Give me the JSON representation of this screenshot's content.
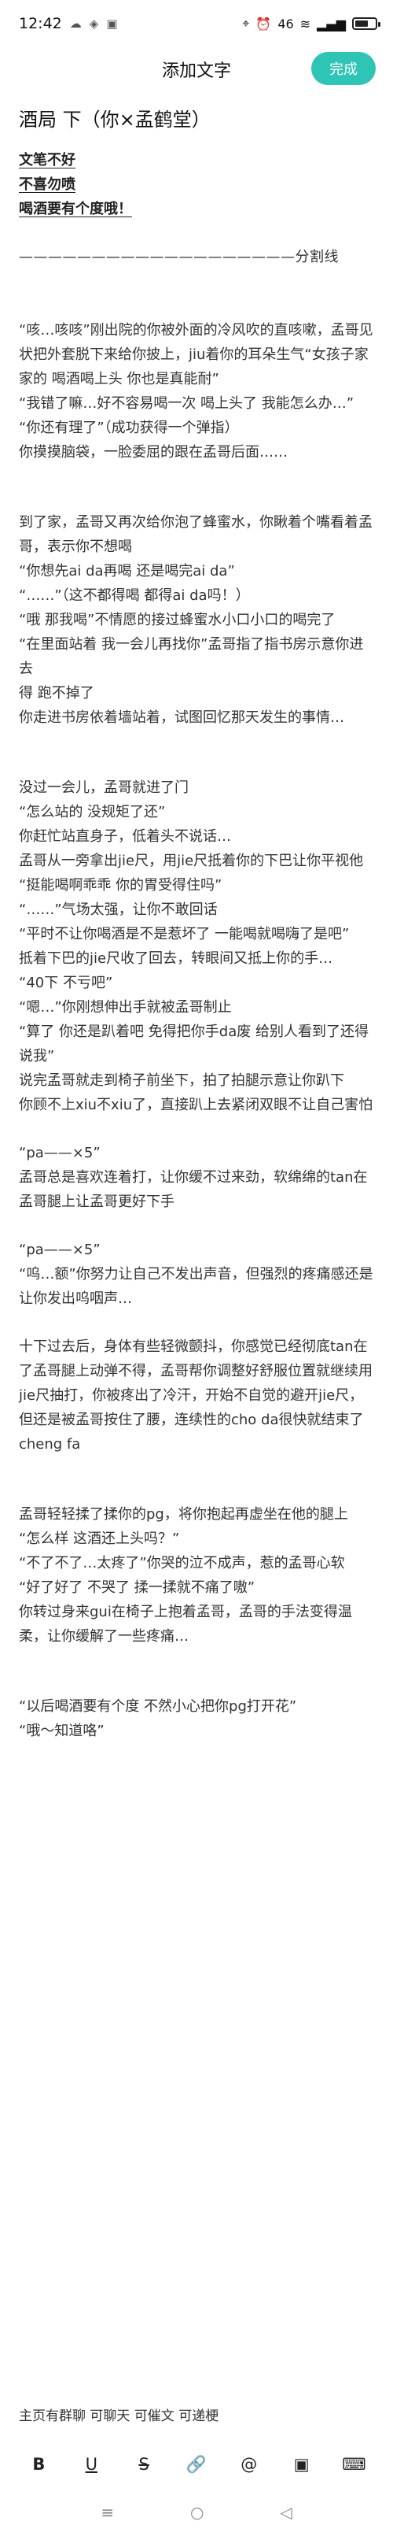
{
  "status_bar": {
    "time": "12:42",
    "signal": "46",
    "battery_level": 0.65
  },
  "header": {
    "title": "添加文字",
    "done_label": "完成"
  },
  "document": {
    "title": "酒局 下（你×孟鹤堂）",
    "warnings": [
      "文笔不好",
      "不喜勿喷",
      "喝酒要有个度哦！"
    ],
    "divider": "———————————————————分割线",
    "para1": [
      "“咳…咳咳”刚出院的你被外面的冷风吹的直咳嗽，孟哥见状把外套脱下来给你披上，jiu着你的耳朵生气“女孩子家家的 喝酒喝上头 你也是真能耐”",
      "“我错了嘛…好不容易喝一次 喝上头了 我能怎么办…”",
      "“你还有理了”（成功获得一个弹指）",
      "你摸摸脑袋，一脸委屈的跟在孟哥后面……"
    ],
    "para2": [
      "到了家，孟哥又再次给你泡了蜂蜜水，你瞅着个嘴看着孟哥，表示你不想喝",
      "“你想先ai da再喝 还是喝完ai da”",
      "“……”（这不都得喝 都得ai da吗！）",
      "“哦 那我喝”不情愿的接过蜂蜜水小口小口的喝完了",
      "“在里面站着 我一会儿再找你”孟哥指了指书房示意你进去",
      "得 跑不掉了",
      "你走进书房依着墙站着，试图回忆那天发生的事情…"
    ],
    "para3": [
      "没过一会儿，孟哥就进了门",
      "“怎么站的 没规矩了还”",
      "你赶忙站直身子，低着头不说话…",
      "孟哥从一旁拿出jie尺，用jie尺抵着你的下巴让你平视他",
      "“挺能喝啊乖乖 你的胃受得住吗”",
      "“……”气场太强，让你不敢回话",
      "“平时不让你喝酒是不是惹坏了 一能喝就喝嗨了是吧”",
      "抵着下巴的jie尺收了回去，转眼间又抵上你的手…",
      "“40下 不亏吧”",
      "“嗯…”你刚想伸出手就被孟哥制止",
      "“算了 你还是趴着吧 免得把你手da废 给别人看到了还得说我”",
      "说完孟哥就走到椅子前坐下，拍了拍腿示意让你趴下",
      "你顾不上xiu不xiu了，直接趴上去紧闭双眼不让自己害怕"
    ],
    "para4": [
      "“pa——×5”",
      "孟哥总是喜欢连着打，让你缓不过来劲，软绵绵的tan在孟哥腿上让孟哥更好下手"
    ],
    "para5": [
      "“pa——×5”",
      "“呜…额”你努力让自己不发出声音，但强烈的疼痛感还是让你发出呜咽声…"
    ],
    "para6": [
      "十下过去后，身体有些轻微颤抖，你感觉已经彻底tan在了孟哥腿上动弹不得，孟哥帮你调整好舒服位置就继续用jie尺抽打，你被疼出了冷汗，开始不自觉的避开jie尺，但还是被孟哥按住了腰，连续性的cho da很快就结束了cheng fa"
    ],
    "para7": [
      "孟哥轻轻揉了揉你的pg，将你抱起再虚坐在他的腿上",
      "“怎么样 这酒还上头吗？”",
      "“不了不了…太疼了”你哭的泣不成声，惹的孟哥心软",
      "“好了好了 不哭了 揉一揉就不痛了嗷”",
      "你转过身来gui在椅子上抱着孟哥，孟哥的手法变得温柔，让你缓解了一些疼痛…"
    ],
    "para8": [
      "“以后喝酒要有个度 不然小心把你pg打开花”",
      "“哦～知道咯”"
    ]
  },
  "footer_text": "主页有群聊 可聊天 可催文 可递梗",
  "toolbar": {
    "bold": "B",
    "underline": "U",
    "strike": "S",
    "link": "🔗",
    "mention": "@",
    "image": "▣",
    "keyboard": "⌨"
  },
  "navbar": {
    "menu": "≡",
    "home": "○",
    "back": "◁"
  }
}
